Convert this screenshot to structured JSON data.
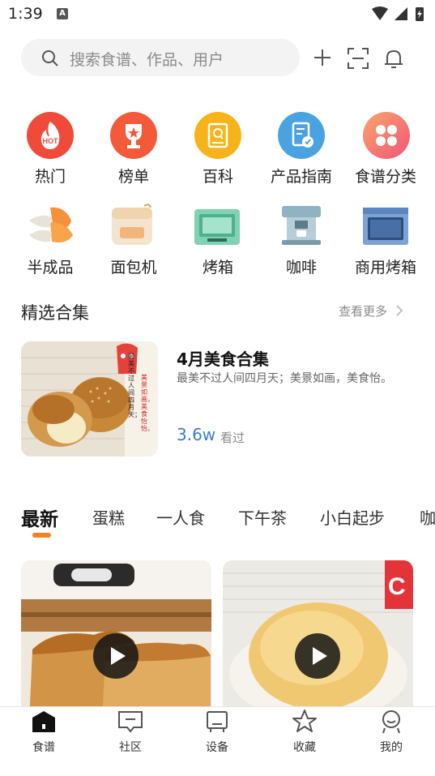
{
  "status": {
    "time": "1:39",
    "notif_icon_letter": "A"
  },
  "search": {
    "placeholder": "搜索食谱、作品、用户"
  },
  "categories": [
    {
      "label": "热门",
      "badge": "HOT"
    },
    {
      "label": "榜单"
    },
    {
      "label": "百科"
    },
    {
      "label": "产品指南"
    },
    {
      "label": "食谱分类"
    },
    {
      "label": "半成品"
    },
    {
      "label": "面包机"
    },
    {
      "label": "烤箱"
    },
    {
      "label": "咖啡"
    },
    {
      "label": "商用烤箱"
    }
  ],
  "featured": {
    "title": "精选合集",
    "more": "查看更多",
    "collection": {
      "title": "4月美食合集",
      "description": "最美不过人间四月天；美景如画，美食怡。",
      "views": "3.6w",
      "views_label": "看过",
      "image_caption_1": "最美不过人间四月天；",
      "image_caption_2": "美景如画，美食怡怡。"
    }
  },
  "tabs": [
    "最新",
    "蛋糕",
    "一人食",
    "下午茶",
    "小白起步",
    "咖"
  ],
  "nav": [
    {
      "label": "食谱",
      "icon": "home-icon"
    },
    {
      "label": "社区",
      "icon": "chat-icon"
    },
    {
      "label": "设备",
      "icon": "device-icon"
    },
    {
      "label": "收藏",
      "icon": "star-icon"
    },
    {
      "label": "我的",
      "icon": "profile-icon"
    }
  ],
  "colors": {
    "accent": "#f5821f",
    "views": "#3a7bd5",
    "hot": "#f04b3a",
    "rank": "#f25a3a",
    "wiki": "#f7b31a",
    "guide": "#4aa3e0"
  }
}
